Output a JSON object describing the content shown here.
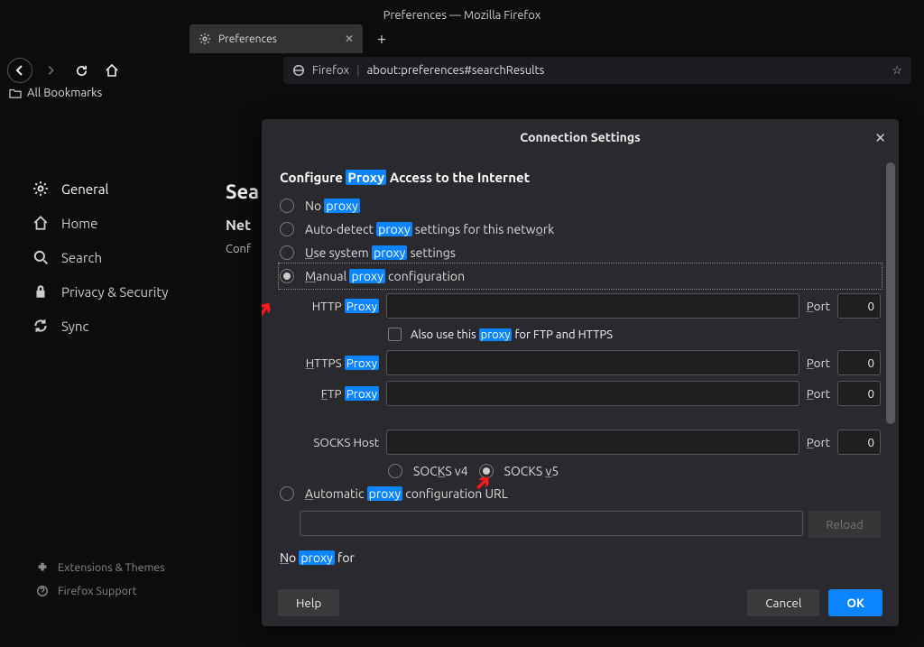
{
  "window": {
    "title": "Preferences — Mozilla Firefox"
  },
  "tab": {
    "label": "Preferences"
  },
  "urlbar": {
    "identity": "Firefox",
    "url": "about:preferences#searchResults"
  },
  "bookmarks": "All Bookmarks",
  "sidebar": {
    "items": [
      {
        "label": "General"
      },
      {
        "label": "Home"
      },
      {
        "label": "Search"
      },
      {
        "label": "Privacy & Security"
      },
      {
        "label": "Sync"
      }
    ],
    "footer": [
      {
        "label": "Extensions & Themes"
      },
      {
        "label": "Firefox Support"
      }
    ]
  },
  "main": {
    "h1": "Sea",
    "h2": "Net",
    "p": "Conf"
  },
  "modal": {
    "title": "Connection Settings",
    "section_title": {
      "pre": "Configure ",
      "hl": "Proxy",
      "post": " Access to the Internet"
    },
    "opts": {
      "no": {
        "pre": "No ",
        "hl": "proxy"
      },
      "auto": {
        "pre": "Auto-detect ",
        "hl": "proxy",
        "post": " settings for this netw",
        "u": "o",
        "post2": "rk"
      },
      "sys": {
        "u": "U",
        "pre": "se system ",
        "hl": "proxy",
        "post": " settings"
      },
      "manual": {
        "u": "M",
        "pre": "anual ",
        "hl": "proxy",
        "post": " configuration"
      },
      "autourl": {
        "u": "A",
        "pre": "utomatic ",
        "hl": "proxy",
        "post": " configuration URL"
      }
    },
    "labels": {
      "http": {
        "pre": "HTTP ",
        "hl": "Proxy"
      },
      "also": {
        "pre": "Also use this ",
        "hl": "proxy",
        "post": " for FTP and HTTPS"
      },
      "https": {
        "u": "H",
        "pre": "TTPS ",
        "hl": "Proxy"
      },
      "ftp": {
        "u": "F",
        "pre": "TP ",
        "hl": "Proxy"
      },
      "socks": "SOCKS Host",
      "port": "Port",
      "socks4": {
        "pre": "SOC",
        "u": "K",
        "post": "S v4"
      },
      "socks5": {
        "pre": "SOCKS ",
        "u": "v",
        "post": "5"
      },
      "reload": "Reload",
      "noproxy": {
        "u": "N",
        "pre": "o ",
        "hl": "proxy",
        "post": " for"
      }
    },
    "values": {
      "port": "0"
    },
    "buttons": {
      "help": "Help",
      "cancel": "Cancel",
      "ok": "OK"
    }
  }
}
